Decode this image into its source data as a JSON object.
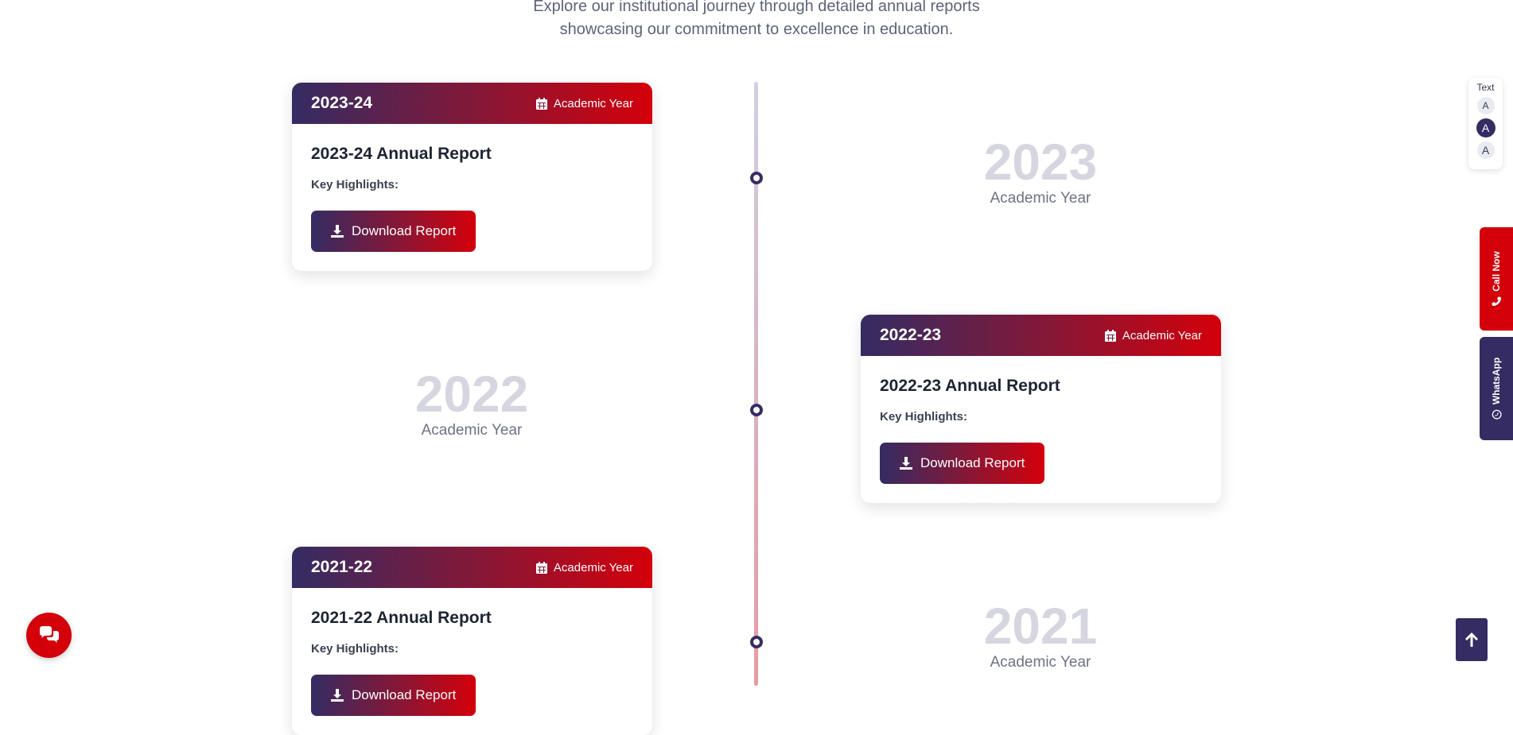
{
  "intro": {
    "line1": "Explore our institutional journey through detailed annual reports",
    "line2": "showcasing our commitment to excellence in education."
  },
  "timeline": [
    {
      "year_tag": "2023-24",
      "badge": "Academic Year",
      "title": "2023-24 Annual Report",
      "highlights_label": "Key Highlights:",
      "button_label": "Download Report",
      "big_year": "2023",
      "big_year_label": "Academic Year"
    },
    {
      "year_tag": "2022-23",
      "badge": "Academic Year",
      "title": "2022-23 Annual Report",
      "highlights_label": "Key Highlights:",
      "button_label": "Download Report",
      "big_year": "2022",
      "big_year_label": "Academic Year"
    },
    {
      "year_tag": "2021-22",
      "badge": "Academic Year",
      "title": "2021-22 Annual Report",
      "highlights_label": "Key Highlights:",
      "button_label": "Download Report",
      "big_year": "2021",
      "big_year_label": "Academic Year"
    }
  ],
  "text_size": {
    "label": "Text",
    "options": [
      "A",
      "A",
      "A"
    ],
    "active_index": 1
  },
  "side_tabs": {
    "call_label": "Call Now",
    "whatsapp_label": "WhatsApp"
  },
  "icons": {
    "calendar": "calendar-icon",
    "download": "download-icon",
    "phone": "phone-icon",
    "whatsapp": "whatsapp-icon",
    "chat": "chat-icon",
    "arrow_up": "arrow-up-icon"
  },
  "colors": {
    "brand_navy": "#342c63",
    "brand_red": "#d4000a",
    "big_year": "#d6d6e1"
  }
}
